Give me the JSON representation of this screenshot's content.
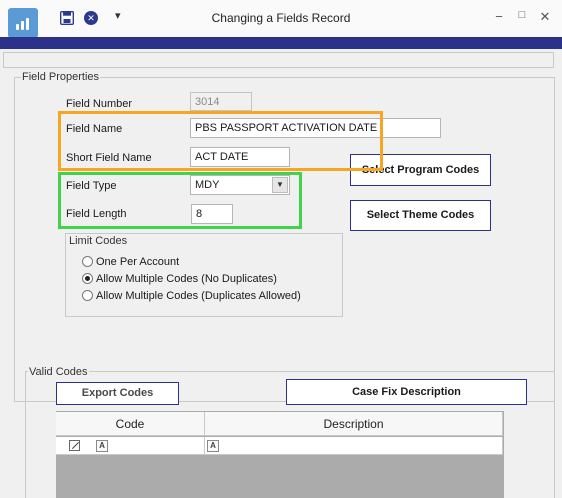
{
  "window": {
    "title": "Changing a Fields Record",
    "minimize": "−",
    "maximize": "□",
    "close": "✕",
    "qa_menu": "▾",
    "close_record_icon": "✕"
  },
  "field_properties": {
    "group_title": "Field Properties",
    "field_number": {
      "label": "Field Number",
      "value": "3014"
    },
    "field_name": {
      "label": "Field Name",
      "value": "PBS PASSPORT ACTIVATION DATE"
    },
    "short_field_name": {
      "label": "Short Field Name",
      "value": "ACT DATE"
    },
    "field_type": {
      "label": "Field Type",
      "value": "MDY",
      "arrow": "▼"
    },
    "field_length": {
      "label": "Field Length",
      "value": "8"
    },
    "select_program_codes": "Select Program Codes",
    "select_theme_codes": "Select Theme Codes",
    "limit_codes": {
      "title": "Limit Codes",
      "options": [
        "One Per Account",
        "Allow Multiple Codes (No Duplicates)",
        "Allow Multiple Codes (Duplicates Allowed)"
      ],
      "selected_index": 1
    }
  },
  "valid_codes": {
    "group_title": "Valid Codes",
    "export_codes": "Export Codes",
    "case_fix_description": "Case Fix Description",
    "columns": [
      "Code",
      "Description"
    ],
    "filter_icon_glyph": "A"
  },
  "colors": {
    "accent_nav": "#2c318a",
    "highlight_orange": "#f5a623",
    "highlight_green": "#45d14a",
    "app_icon": "#5b9bd5"
  },
  "icons": [
    "app-logo-icon",
    "save-icon",
    "close-circle-icon",
    "quick-access-menu-icon",
    "minimize-icon",
    "maximize-icon",
    "close-icon",
    "dropdown-arrow-icon",
    "edit-row-icon",
    "text-filter-icon"
  ]
}
